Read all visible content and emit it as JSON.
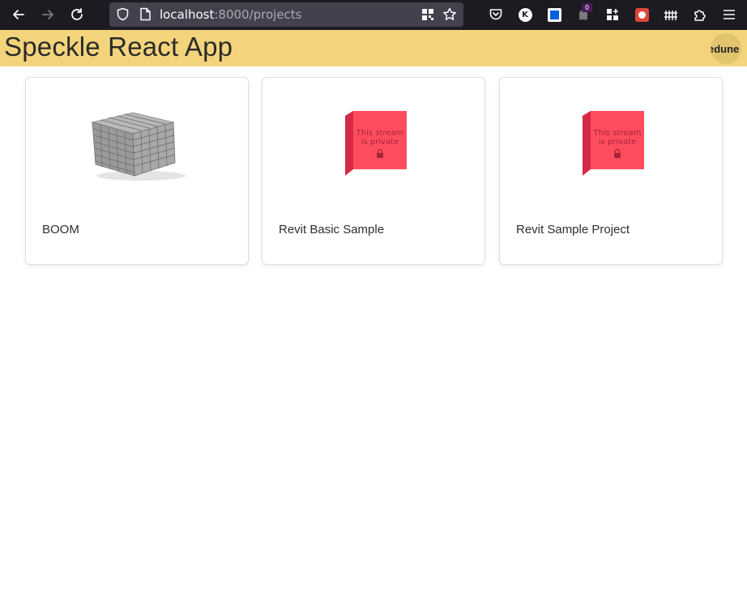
{
  "browser": {
    "url_host": "localhost",
    "url_path": ":8000/projects",
    "badge_count": "0",
    "extension_k_label": "K"
  },
  "header": {
    "title": "Speckle React App",
    "avatar_text": "edune"
  },
  "projects": [
    {
      "name": "BOOM",
      "thumbnail": "building-model"
    },
    {
      "name": "Revit Basic Sample",
      "thumbnail": "private-stream",
      "private_line1": "This stream",
      "private_line2": "is private"
    },
    {
      "name": "Revit Sample Project",
      "thumbnail": "private-stream",
      "private_line1": "This stream",
      "private_line2": "is private"
    }
  ],
  "colors": {
    "header_bg": "#f3d47c",
    "private_box": "#ff4d5e",
    "browser_bg": "#1c1b22"
  }
}
